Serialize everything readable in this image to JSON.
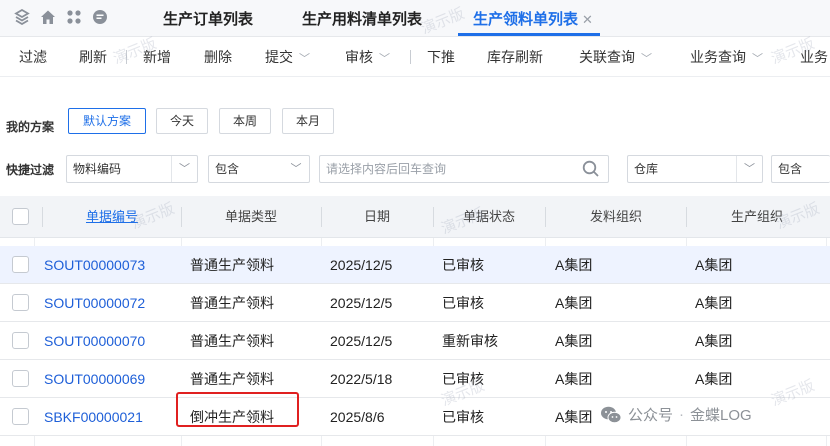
{
  "tabs": [
    {
      "label": "生产订单列表",
      "active": false
    },
    {
      "label": "生产用料清单列表",
      "active": false
    },
    {
      "label": "生产领料单列表",
      "active": true
    }
  ],
  "toolbar": {
    "filter": "过滤",
    "refresh": "刷新",
    "add": "新增",
    "delete": "删除",
    "submit": "提交",
    "audit": "审核",
    "push_down": "下推",
    "inventory_refresh": "库存刷新",
    "related_query": "关联查询",
    "business_query": "业务查询",
    "business_cut": "业务"
  },
  "scheme": {
    "label": "我的方案",
    "default": "默认方案",
    "today": "今天",
    "this_week": "本周",
    "this_month": "本月"
  },
  "quick_filter": {
    "label": "快捷过滤",
    "field": "物料编码",
    "operator": "包含",
    "placeholder": "请选择内容后回车查询",
    "field2": "仓库",
    "operator2": "包含"
  },
  "table": {
    "headers": [
      "单据编号",
      "单据类型",
      "日期",
      "单据状态",
      "发料组织",
      "生产组织"
    ],
    "rows": [
      {
        "no": "SOUT00000073",
        "type": "普通生产领料",
        "date": "2025/12/5",
        "status": "已审核",
        "issue_org": "A集团",
        "prod_org": "A集团"
      },
      {
        "no": "SOUT00000072",
        "type": "普通生产领料",
        "date": "2025/12/5",
        "status": "已审核",
        "issue_org": "A集团",
        "prod_org": "A集团"
      },
      {
        "no": "SOUT00000070",
        "type": "普通生产领料",
        "date": "2025/12/5",
        "status": "重新审核",
        "issue_org": "A集团",
        "prod_org": "A集团"
      },
      {
        "no": "SOUT00000069",
        "type": "普通生产领料",
        "date": "2022/5/18",
        "status": "已审核",
        "issue_org": "A集团",
        "prod_org": "A集团"
      },
      {
        "no": "SBKF00000021",
        "type": "倒冲生产领料",
        "date": "2025/8/6",
        "status": "已审核",
        "issue_org": "A集团",
        "prod_org": "A集团"
      }
    ]
  },
  "watermark": "演示版",
  "brand": {
    "account": "公众号",
    "name": "金蝶LOG"
  },
  "colors": {
    "accent": "#1e6fe8",
    "highlight": "#e02020",
    "selected_row": "#eef3ff"
  }
}
